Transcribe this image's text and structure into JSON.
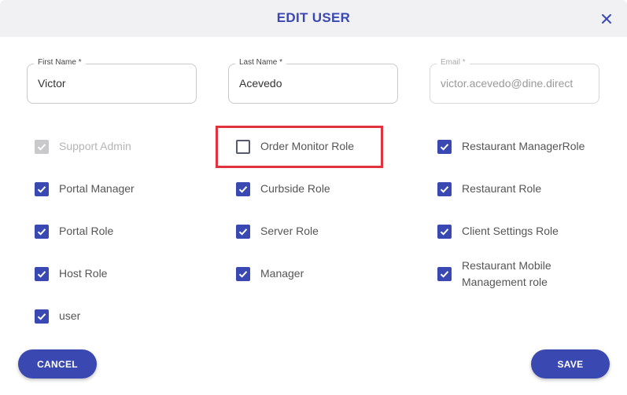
{
  "dialog": {
    "title": "EDIT USER",
    "close_icon": "close-icon"
  },
  "fields": {
    "first_name": {
      "label": "First Name *",
      "value": "Victor"
    },
    "last_name": {
      "label": "Last Name *",
      "value": "Acevedo"
    },
    "email": {
      "label": "Email *",
      "value": "victor.acevedo@dine.direct",
      "disabled": true
    }
  },
  "roles": {
    "col1": [
      {
        "label": "Support Admin",
        "checked": true,
        "disabled": true
      },
      {
        "label": "Portal Manager",
        "checked": true
      },
      {
        "label": "Portal Role",
        "checked": true
      },
      {
        "label": "Host Role",
        "checked": true
      },
      {
        "label": "user",
        "checked": true
      }
    ],
    "col2": [
      {
        "label": "Order Monitor Role",
        "checked": false
      },
      {
        "label": "Curbside Role",
        "checked": true
      },
      {
        "label": "Server Role",
        "checked": true
      },
      {
        "label": "Manager",
        "checked": true
      }
    ],
    "col3": [
      {
        "label": "Restaurant ManagerRole",
        "checked": true
      },
      {
        "label": "Restaurant Role",
        "checked": true
      },
      {
        "label": "Client Settings Role",
        "checked": true
      },
      {
        "label": "Restaurant Mobile Management role",
        "checked": true
      }
    ]
  },
  "buttons": {
    "cancel": "CANCEL",
    "save": "SAVE"
  },
  "colors": {
    "accent": "#3a48b2",
    "highlight": "#e0333d"
  }
}
